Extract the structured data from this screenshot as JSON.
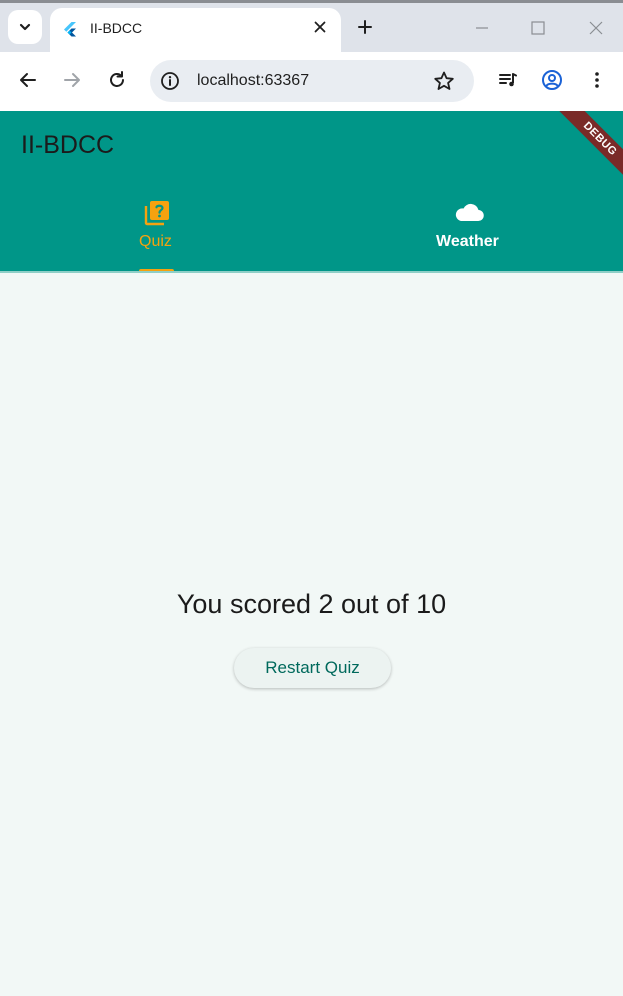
{
  "browser": {
    "tab_title": "II-BDCC",
    "url": "localhost:63367",
    "icons": {
      "tab_search": "chevron-down-icon",
      "close_tab": "close-icon",
      "new_tab": "plus-icon",
      "minimize": "minimize-icon",
      "maximize": "maximize-icon",
      "close_window": "close-window-icon",
      "back": "arrow-back-icon",
      "forward": "arrow-forward-icon",
      "reload": "reload-icon",
      "site_info": "info-icon",
      "bookmark": "star-icon",
      "media": "media-queue-icon",
      "profile": "profile-icon",
      "menu": "more-vert-icon"
    }
  },
  "app": {
    "title": "II-BDCC",
    "debug_banner": "DEBUG",
    "colors": {
      "primary": "#009688",
      "selected_tab": "#f5a20f",
      "debug_banner": "#7a2a28",
      "button_text": "#00695c"
    },
    "tabs": [
      {
        "label": "Quiz",
        "icon": "quiz-icon",
        "selected": true
      },
      {
        "label": "Weather",
        "icon": "cloud-icon",
        "selected": false
      }
    ],
    "result": {
      "score_text": "You scored 2 out of 10",
      "restart_label": "Restart Quiz"
    }
  }
}
